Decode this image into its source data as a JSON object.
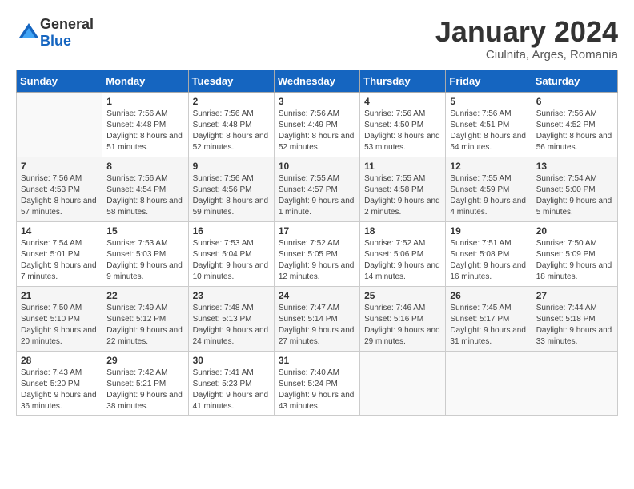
{
  "header": {
    "logo_general": "General",
    "logo_blue": "Blue",
    "title": "January 2024",
    "subtitle": "Ciulnita, Arges, Romania"
  },
  "weekdays": [
    "Sunday",
    "Monday",
    "Tuesday",
    "Wednesday",
    "Thursday",
    "Friday",
    "Saturday"
  ],
  "weeks": [
    [
      {
        "day": "",
        "sunrise": "",
        "sunset": "",
        "daylight": ""
      },
      {
        "day": "1",
        "sunrise": "Sunrise: 7:56 AM",
        "sunset": "Sunset: 4:48 PM",
        "daylight": "Daylight: 8 hours and 51 minutes."
      },
      {
        "day": "2",
        "sunrise": "Sunrise: 7:56 AM",
        "sunset": "Sunset: 4:48 PM",
        "daylight": "Daylight: 8 hours and 52 minutes."
      },
      {
        "day": "3",
        "sunrise": "Sunrise: 7:56 AM",
        "sunset": "Sunset: 4:49 PM",
        "daylight": "Daylight: 8 hours and 52 minutes."
      },
      {
        "day": "4",
        "sunrise": "Sunrise: 7:56 AM",
        "sunset": "Sunset: 4:50 PM",
        "daylight": "Daylight: 8 hours and 53 minutes."
      },
      {
        "day": "5",
        "sunrise": "Sunrise: 7:56 AM",
        "sunset": "Sunset: 4:51 PM",
        "daylight": "Daylight: 8 hours and 54 minutes."
      },
      {
        "day": "6",
        "sunrise": "Sunrise: 7:56 AM",
        "sunset": "Sunset: 4:52 PM",
        "daylight": "Daylight: 8 hours and 56 minutes."
      }
    ],
    [
      {
        "day": "7",
        "sunrise": "Sunrise: 7:56 AM",
        "sunset": "Sunset: 4:53 PM",
        "daylight": "Daylight: 8 hours and 57 minutes."
      },
      {
        "day": "8",
        "sunrise": "Sunrise: 7:56 AM",
        "sunset": "Sunset: 4:54 PM",
        "daylight": "Daylight: 8 hours and 58 minutes."
      },
      {
        "day": "9",
        "sunrise": "Sunrise: 7:56 AM",
        "sunset": "Sunset: 4:56 PM",
        "daylight": "Daylight: 8 hours and 59 minutes."
      },
      {
        "day": "10",
        "sunrise": "Sunrise: 7:55 AM",
        "sunset": "Sunset: 4:57 PM",
        "daylight": "Daylight: 9 hours and 1 minute."
      },
      {
        "day": "11",
        "sunrise": "Sunrise: 7:55 AM",
        "sunset": "Sunset: 4:58 PM",
        "daylight": "Daylight: 9 hours and 2 minutes."
      },
      {
        "day": "12",
        "sunrise": "Sunrise: 7:55 AM",
        "sunset": "Sunset: 4:59 PM",
        "daylight": "Daylight: 9 hours and 4 minutes."
      },
      {
        "day": "13",
        "sunrise": "Sunrise: 7:54 AM",
        "sunset": "Sunset: 5:00 PM",
        "daylight": "Daylight: 9 hours and 5 minutes."
      }
    ],
    [
      {
        "day": "14",
        "sunrise": "Sunrise: 7:54 AM",
        "sunset": "Sunset: 5:01 PM",
        "daylight": "Daylight: 9 hours and 7 minutes."
      },
      {
        "day": "15",
        "sunrise": "Sunrise: 7:53 AM",
        "sunset": "Sunset: 5:03 PM",
        "daylight": "Daylight: 9 hours and 9 minutes."
      },
      {
        "day": "16",
        "sunrise": "Sunrise: 7:53 AM",
        "sunset": "Sunset: 5:04 PM",
        "daylight": "Daylight: 9 hours and 10 minutes."
      },
      {
        "day": "17",
        "sunrise": "Sunrise: 7:52 AM",
        "sunset": "Sunset: 5:05 PM",
        "daylight": "Daylight: 9 hours and 12 minutes."
      },
      {
        "day": "18",
        "sunrise": "Sunrise: 7:52 AM",
        "sunset": "Sunset: 5:06 PM",
        "daylight": "Daylight: 9 hours and 14 minutes."
      },
      {
        "day": "19",
        "sunrise": "Sunrise: 7:51 AM",
        "sunset": "Sunset: 5:08 PM",
        "daylight": "Daylight: 9 hours and 16 minutes."
      },
      {
        "day": "20",
        "sunrise": "Sunrise: 7:50 AM",
        "sunset": "Sunset: 5:09 PM",
        "daylight": "Daylight: 9 hours and 18 minutes."
      }
    ],
    [
      {
        "day": "21",
        "sunrise": "Sunrise: 7:50 AM",
        "sunset": "Sunset: 5:10 PM",
        "daylight": "Daylight: 9 hours and 20 minutes."
      },
      {
        "day": "22",
        "sunrise": "Sunrise: 7:49 AM",
        "sunset": "Sunset: 5:12 PM",
        "daylight": "Daylight: 9 hours and 22 minutes."
      },
      {
        "day": "23",
        "sunrise": "Sunrise: 7:48 AM",
        "sunset": "Sunset: 5:13 PM",
        "daylight": "Daylight: 9 hours and 24 minutes."
      },
      {
        "day": "24",
        "sunrise": "Sunrise: 7:47 AM",
        "sunset": "Sunset: 5:14 PM",
        "daylight": "Daylight: 9 hours and 27 minutes."
      },
      {
        "day": "25",
        "sunrise": "Sunrise: 7:46 AM",
        "sunset": "Sunset: 5:16 PM",
        "daylight": "Daylight: 9 hours and 29 minutes."
      },
      {
        "day": "26",
        "sunrise": "Sunrise: 7:45 AM",
        "sunset": "Sunset: 5:17 PM",
        "daylight": "Daylight: 9 hours and 31 minutes."
      },
      {
        "day": "27",
        "sunrise": "Sunrise: 7:44 AM",
        "sunset": "Sunset: 5:18 PM",
        "daylight": "Daylight: 9 hours and 33 minutes."
      }
    ],
    [
      {
        "day": "28",
        "sunrise": "Sunrise: 7:43 AM",
        "sunset": "Sunset: 5:20 PM",
        "daylight": "Daylight: 9 hours and 36 minutes."
      },
      {
        "day": "29",
        "sunrise": "Sunrise: 7:42 AM",
        "sunset": "Sunset: 5:21 PM",
        "daylight": "Daylight: 9 hours and 38 minutes."
      },
      {
        "day": "30",
        "sunrise": "Sunrise: 7:41 AM",
        "sunset": "Sunset: 5:23 PM",
        "daylight": "Daylight: 9 hours and 41 minutes."
      },
      {
        "day": "31",
        "sunrise": "Sunrise: 7:40 AM",
        "sunset": "Sunset: 5:24 PM",
        "daylight": "Daylight: 9 hours and 43 minutes."
      },
      {
        "day": "",
        "sunrise": "",
        "sunset": "",
        "daylight": ""
      },
      {
        "day": "",
        "sunrise": "",
        "sunset": "",
        "daylight": ""
      },
      {
        "day": "",
        "sunrise": "",
        "sunset": "",
        "daylight": ""
      }
    ]
  ]
}
